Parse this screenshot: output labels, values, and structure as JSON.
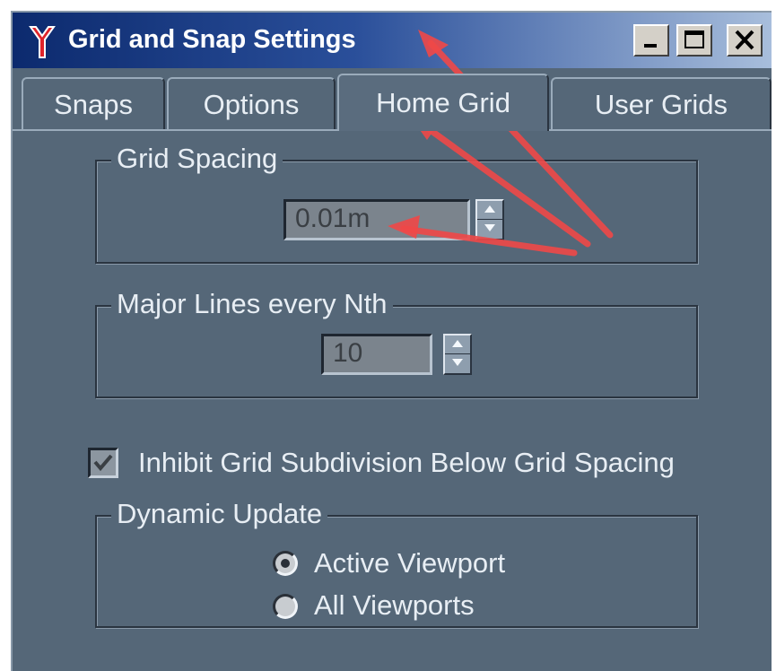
{
  "window": {
    "title": "Grid and Snap Settings",
    "icon": "app-logo-icon",
    "buttons": [
      "minimize-icon",
      "maximize-icon",
      "close-icon"
    ]
  },
  "tabs": [
    {
      "label": "Snaps",
      "active": false
    },
    {
      "label": "Options",
      "active": false
    },
    {
      "label": "Home Grid",
      "active": true
    },
    {
      "label": "User Grids",
      "active": false
    }
  ],
  "grid_spacing": {
    "label": "Grid Spacing",
    "value": "0.01m"
  },
  "major_lines": {
    "label": "Major Lines every Nth",
    "value": "10"
  },
  "inhibit": {
    "label": "Inhibit Grid Subdivision Below Grid Spacing",
    "checked": true
  },
  "dynamic_update": {
    "label": "Dynamic Update",
    "options": [
      {
        "label": "Active Viewport",
        "selected": true
      },
      {
        "label": "All Viewports",
        "selected": false
      }
    ]
  },
  "annotation_color": "#f04848"
}
